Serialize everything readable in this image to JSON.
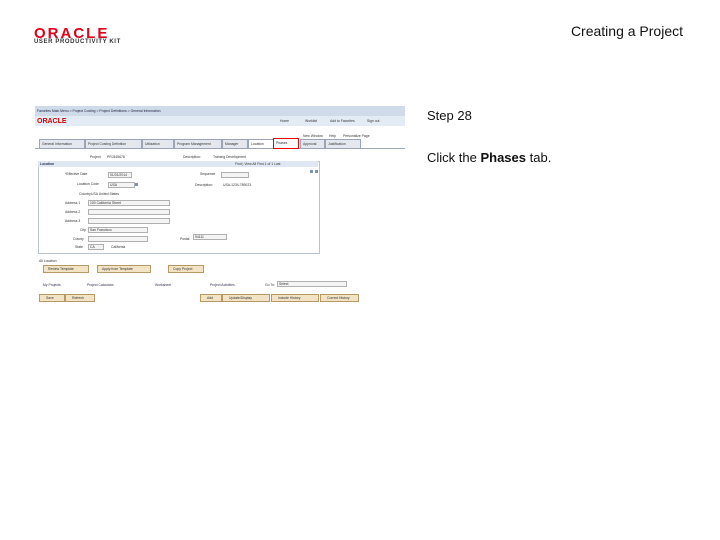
{
  "header": {
    "brand": "ORACLE",
    "brand_sub": "USER PRODUCTIVITY KIT",
    "slide_title": "Creating a Project"
  },
  "step": {
    "number_label": "Step 28",
    "instruction_prefix": "Click the ",
    "instruction_target": "Phases",
    "instruction_suffix": " tab."
  },
  "screenshot": {
    "breadcrumb": "Favorites   Main Menu  >  Project Costing  >  Project Definitions  >  General Information",
    "top_links": [
      "Home",
      "Worklist",
      "Add to Favorites",
      "Sign out"
    ],
    "brand": "ORACLE",
    "top_right_links": [
      "New Window",
      "Help",
      "Personalize Page"
    ],
    "tabs": [
      "General Information",
      "Project Costing Definition",
      "Utilization",
      "Program Management",
      "Manager",
      "Location",
      "Phases",
      "Approval",
      "Justification"
    ],
    "highlighted_tab": "Phases",
    "project_label": "Project:",
    "project_value": "PRJ345678",
    "desc_label": "Description:",
    "desc_value": "Training Development",
    "section_title": "Location",
    "section_nav": "Find | View All    First  1 of 1  Last",
    "effective_date_label": "*Effective Date",
    "effective_date_value": "01/01/2014",
    "sequence_label": "Sequence",
    "location_label": "Location Code",
    "location_value": "USA",
    "description_label": "Description:",
    "description_value": "USA-1234-789023",
    "country_label": "Country",
    "country_value": "USA  United States",
    "address1_label": "Address 1",
    "address1_value": "100 California Street",
    "address2_label": "Address 2",
    "address3_label": "Address 3",
    "city_label": "City",
    "city_value": "San Francisco",
    "county_label": "County",
    "postal_label": "Postal",
    "postal_value": "94111",
    "state_label": "State",
    "state_value": "CA",
    "state_desc": "California",
    "related_label": "All Location",
    "buttons": [
      "Review Template",
      "Apply from Template",
      "Copy Project"
    ],
    "links": [
      "My Projects",
      "Project Calculator",
      "Worksheet",
      "Project Activities"
    ],
    "goto_label": "Go To:",
    "goto_value": "Select",
    "toolbar": [
      "Save",
      "Refresh",
      "Add",
      "Update/Display",
      "Include History",
      "Correct History"
    ]
  }
}
